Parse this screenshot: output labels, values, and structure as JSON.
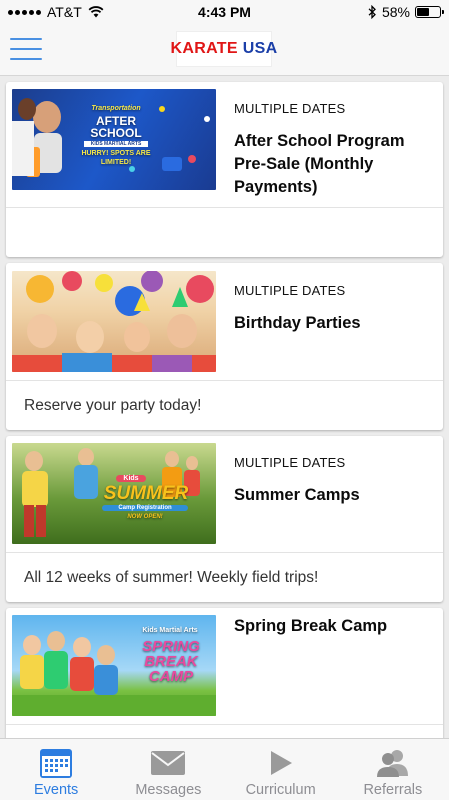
{
  "status_bar": {
    "carrier": "AT&T",
    "time": "4:43 PM",
    "battery": "58%",
    "battery_level": 0.58
  },
  "header": {
    "logo_word1": "KARATE",
    "logo_word2": "USA",
    "logo_colors": {
      "word1": "#e01616",
      "word2": "#1b3fa8"
    }
  },
  "events": [
    {
      "dates": "MULTIPLE DATES",
      "title": "After School Program Pre-Sale (Monthly Payments)",
      "description": "",
      "image_text": {
        "line1": "Transportation",
        "line2": "AFTER SCHOOL",
        "line3": "KIDS MARTIAL ARTS",
        "line4": "HURRY! SPOTS ARE LIMITED!"
      }
    },
    {
      "dates": "MULTIPLE DATES",
      "title": "Birthday Parties",
      "description": "Reserve your party today!"
    },
    {
      "dates": "MULTIPLE DATES",
      "title": "Summer Camps",
      "description": "All 12 weeks of summer! Weekly field trips!",
      "image_text": {
        "line1": "Kids",
        "line2": "SUMMER",
        "line3": "Camp Registration",
        "line4": "NOW OPEN!"
      }
    },
    {
      "dates": "",
      "title": "Spring Break Camp",
      "description": "",
      "image_text": {
        "line1": "Kids Martial Arts",
        "line2": "SPRING BREAK CAMP"
      }
    }
  ],
  "tabs": [
    {
      "label": "Events",
      "icon": "calendar-icon",
      "active": true
    },
    {
      "label": "Messages",
      "icon": "envelope-icon",
      "active": false
    },
    {
      "label": "Curriculum",
      "icon": "play-icon",
      "active": false
    },
    {
      "label": "Referrals",
      "icon": "people-icon",
      "active": false
    }
  ],
  "colors": {
    "accent": "#2d7de0",
    "hamburger": "#4a90e2",
    "inactive_tab": "#8e8e93"
  }
}
